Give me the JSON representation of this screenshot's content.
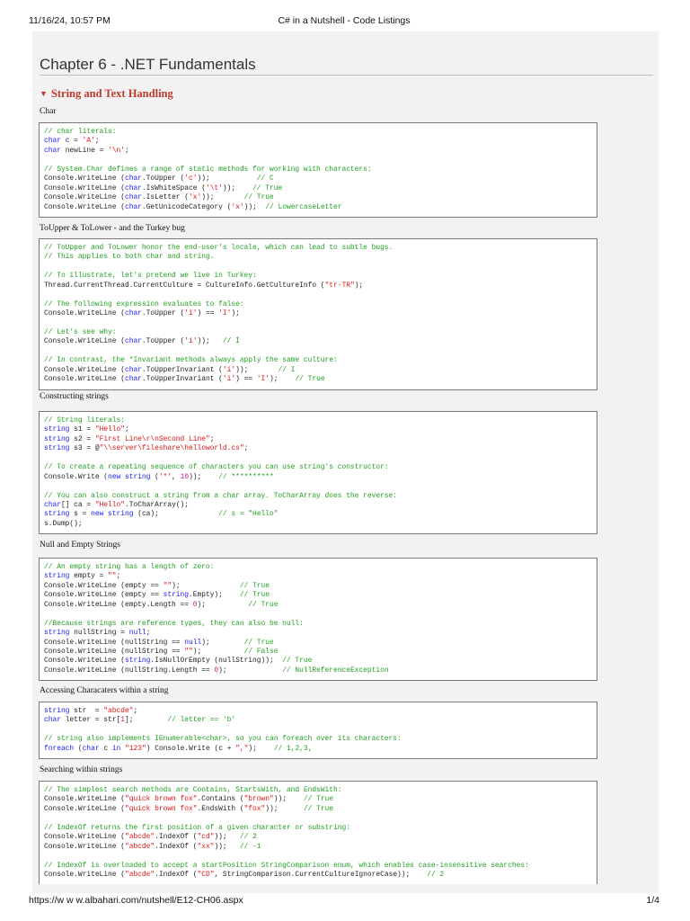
{
  "header": {
    "datetime": "11/16/24, 10:57 PM",
    "doc_title": "C# in a Nutshell - Code Listings"
  },
  "footer": {
    "url": "https://w w w.albahari.com/nutshell/E12-CH06.aspx",
    "page": "1/4"
  },
  "chapter_title": "Chapter 6 - .NET Fundamentals",
  "section": {
    "icon": "triangle-down-icon",
    "title": "String and Text Handling"
  },
  "colors": {
    "comment": "#22a022",
    "keyword": "#1a1aff",
    "string": "#e01515",
    "number": "#c0188c",
    "section": "#c0392b"
  },
  "blocks": [
    {
      "label": "Char",
      "lines": [
        [
          [
            "c",
            "// char literals:"
          ]
        ],
        [
          [
            "k",
            "char"
          ],
          [
            "p",
            " c = "
          ],
          [
            "s",
            "'A'"
          ],
          [
            "p",
            ";"
          ]
        ],
        [
          [
            "k",
            "char"
          ],
          [
            "p",
            " newLine = "
          ],
          [
            "s",
            "'\\n'"
          ],
          [
            "p",
            ";"
          ]
        ],
        [],
        [
          [
            "c",
            "// System.Char defines a range of static methods for working with characters:"
          ]
        ],
        [
          [
            "p",
            "Console.WriteLine ("
          ],
          [
            "k",
            "char"
          ],
          [
            "p",
            ".ToUpper ("
          ],
          [
            "s",
            "'c'"
          ],
          [
            "p",
            "));           "
          ],
          [
            "c",
            "// C"
          ]
        ],
        [
          [
            "p",
            "Console.WriteLine ("
          ],
          [
            "k",
            "char"
          ],
          [
            "p",
            ".IsWhiteSpace ("
          ],
          [
            "s",
            "'\\t'"
          ],
          [
            "p",
            "));    "
          ],
          [
            "c",
            "// True"
          ]
        ],
        [
          [
            "p",
            "Console.WriteLine ("
          ],
          [
            "k",
            "char"
          ],
          [
            "p",
            ".IsLetter ("
          ],
          [
            "s",
            "'x'"
          ],
          [
            "p",
            "));       "
          ],
          [
            "c",
            "// True"
          ]
        ],
        [
          [
            "p",
            "Console.WriteLine ("
          ],
          [
            "k",
            "char"
          ],
          [
            "p",
            ".GetUnicodeCategory ("
          ],
          [
            "s",
            "'x'"
          ],
          [
            "p",
            "));  "
          ],
          [
            "c",
            "// LowercaseLetter"
          ]
        ]
      ]
    },
    {
      "label": "ToUpper & ToLower - and the Turkey bug",
      "lines": [
        [
          [
            "c",
            "// ToUpper and ToLower honor the end-user's locale, which can lead to subtle bugs."
          ]
        ],
        [
          [
            "c",
            "// This applies to both char and string."
          ]
        ],
        [],
        [
          [
            "c",
            "// To illustrate, let's pretend we live in Turkey:"
          ]
        ],
        [
          [
            "p",
            "Thread.CurrentThread.CurrentCulture = CultureInfo.GetCultureInfo ("
          ],
          [
            "s",
            "\"tr-TR\""
          ],
          [
            "p",
            ");"
          ]
        ],
        [],
        [
          [
            "c",
            "// The following expression evaluates to false:"
          ]
        ],
        [
          [
            "p",
            "Console.WriteLine ("
          ],
          [
            "k",
            "char"
          ],
          [
            "p",
            ".ToUpper ("
          ],
          [
            "s",
            "'i'"
          ],
          [
            "p",
            ") == "
          ],
          [
            "s",
            "'I'"
          ],
          [
            "p",
            ");"
          ]
        ],
        [],
        [
          [
            "c",
            "// Let's see why:"
          ]
        ],
        [
          [
            "p",
            "Console.WriteLine ("
          ],
          [
            "k",
            "char"
          ],
          [
            "p",
            ".ToUpper ("
          ],
          [
            "s",
            "'i'"
          ],
          [
            "p",
            "));   "
          ],
          [
            "c",
            "// İ"
          ]
        ],
        [],
        [
          [
            "c",
            "// In contrast, the *Invariant methods always apply the same culture:"
          ]
        ],
        [
          [
            "p",
            "Console.WriteLine ("
          ],
          [
            "k",
            "char"
          ],
          [
            "p",
            ".ToUpperInvariant ("
          ],
          [
            "s",
            "'i'"
          ],
          [
            "p",
            "));       "
          ],
          [
            "c",
            "// I"
          ]
        ],
        [
          [
            "p",
            "Console.WriteLine ("
          ],
          [
            "k",
            "char"
          ],
          [
            "p",
            ".ToUpperInvariant ("
          ],
          [
            "s",
            "'i'"
          ],
          [
            "p",
            ") == "
          ],
          [
            "s",
            "'I'"
          ],
          [
            "p",
            ");    "
          ],
          [
            "c",
            "// True"
          ]
        ]
      ]
    },
    {
      "label": "Constructing strings",
      "lines": [
        [
          [
            "c",
            "// String literals:"
          ]
        ],
        [
          [
            "k",
            "string"
          ],
          [
            "p",
            " s1 = "
          ],
          [
            "s",
            "\"Hello\""
          ],
          [
            "p",
            ";"
          ]
        ],
        [
          [
            "k",
            "string"
          ],
          [
            "p",
            " s2 = "
          ],
          [
            "s",
            "\"First Line\\r\\nSecond Line\""
          ],
          [
            "p",
            ";"
          ]
        ],
        [
          [
            "k",
            "string"
          ],
          [
            "p",
            " s3 = @"
          ],
          [
            "s",
            "\"\\\\server\\fileshare\\helloworld.cs\""
          ],
          [
            "p",
            ";"
          ]
        ],
        [],
        [
          [
            "c",
            "// To create a repeating sequence of characters you can use string's constructor:"
          ]
        ],
        [
          [
            "p",
            "Console.Write ("
          ],
          [
            "k",
            "new string"
          ],
          [
            "p",
            " ("
          ],
          [
            "s",
            "'*'"
          ],
          [
            "p",
            ", "
          ],
          [
            "n",
            "10"
          ],
          [
            "p",
            "));    "
          ],
          [
            "c",
            "// **********"
          ]
        ],
        [],
        [
          [
            "c",
            "// You can also construct a string from a char array. ToCharArray does the reverse:"
          ]
        ],
        [
          [
            "k",
            "char"
          ],
          [
            "p",
            "[] ca = "
          ],
          [
            "s",
            "\"Hello\""
          ],
          [
            "p",
            ".ToCharArray();"
          ]
        ],
        [
          [
            "k",
            "string"
          ],
          [
            "p",
            " s = "
          ],
          [
            "k",
            "new string"
          ],
          [
            "p",
            " (ca);              "
          ],
          [
            "c",
            "// s = \"Hello\""
          ]
        ],
        [
          [
            "p",
            "s.Dump();"
          ]
        ]
      ]
    },
    {
      "label": "Null and Empty Strings",
      "lines": [
        [
          [
            "c",
            "// An empty string has a length of zero:"
          ]
        ],
        [
          [
            "k",
            "string"
          ],
          [
            "p",
            " empty = "
          ],
          [
            "s",
            "\"\""
          ],
          [
            "p",
            ";"
          ]
        ],
        [
          [
            "p",
            "Console.WriteLine (empty == "
          ],
          [
            "s",
            "\"\""
          ],
          [
            "p",
            ");              "
          ],
          [
            "c",
            "// True"
          ]
        ],
        [
          [
            "p",
            "Console.WriteLine (empty == "
          ],
          [
            "k",
            "string"
          ],
          [
            "p",
            ".Empty);    "
          ],
          [
            "c",
            "// True"
          ]
        ],
        [
          [
            "p",
            "Console.WriteLine (empty.Length == "
          ],
          [
            "n",
            "0"
          ],
          [
            "p",
            ");          "
          ],
          [
            "c",
            "// True"
          ]
        ],
        [],
        [
          [
            "c",
            "//Because strings are reference types, they can also be null:"
          ]
        ],
        [
          [
            "k",
            "string"
          ],
          [
            "p",
            " nullString = "
          ],
          [
            "k",
            "null"
          ],
          [
            "p",
            ";"
          ]
        ],
        [
          [
            "p",
            "Console.WriteLine (nullString == "
          ],
          [
            "k",
            "null"
          ],
          [
            "p",
            ");        "
          ],
          [
            "c",
            "// True"
          ]
        ],
        [
          [
            "p",
            "Console.WriteLine (nullString == "
          ],
          [
            "s",
            "\"\""
          ],
          [
            "p",
            ");          "
          ],
          [
            "c",
            "// False"
          ]
        ],
        [
          [
            "p",
            "Console.WriteLine ("
          ],
          [
            "k",
            "string"
          ],
          [
            "p",
            ".IsNullOrEmpty (nullString));  "
          ],
          [
            "c",
            "// True"
          ]
        ],
        [
          [
            "p",
            "Console.WriteLine (nullString.Length == "
          ],
          [
            "n",
            "0"
          ],
          [
            "p",
            ");             "
          ],
          [
            "c",
            "// NullReferenceException"
          ]
        ]
      ]
    },
    {
      "label": "Accessing Characaters within a string",
      "lines": [
        [
          [
            "k",
            "string"
          ],
          [
            "p",
            " str  = "
          ],
          [
            "s",
            "\"abcde\""
          ],
          [
            "p",
            ";"
          ]
        ],
        [
          [
            "k",
            "char"
          ],
          [
            "p",
            " letter = str["
          ],
          [
            "n",
            "1"
          ],
          [
            "p",
            "];        "
          ],
          [
            "c",
            "// letter == 'b'"
          ]
        ],
        [],
        [
          [
            "c",
            "// string also implements IEnumerable<char>, so you can foreach over its characters:"
          ]
        ],
        [
          [
            "k",
            "foreach"
          ],
          [
            "p",
            " ("
          ],
          [
            "k",
            "char"
          ],
          [
            "p",
            " c "
          ],
          [
            "k",
            "in"
          ],
          [
            "p",
            " "
          ],
          [
            "s",
            "\"123\""
          ],
          [
            "p",
            ") Console.Write (c + "
          ],
          [
            "s",
            "\",\""
          ],
          [
            "p",
            ");    "
          ],
          [
            "c",
            "// 1,2,3,"
          ]
        ]
      ]
    },
    {
      "label": "Searching within strings",
      "lines": [
        [
          [
            "c",
            "// The simplest search methods are Contains, StartsWith, and EndsWith:"
          ]
        ],
        [
          [
            "p",
            "Console.WriteLine ("
          ],
          [
            "s",
            "\"quick brown fox\""
          ],
          [
            "p",
            ".Contains ("
          ],
          [
            "s",
            "\"brown\""
          ],
          [
            "p",
            "));    "
          ],
          [
            "c",
            "// True"
          ]
        ],
        [
          [
            "p",
            "Console.WriteLine ("
          ],
          [
            "s",
            "\"quick brown fox\""
          ],
          [
            "p",
            ".EndsWith ("
          ],
          [
            "s",
            "\"fox\""
          ],
          [
            "p",
            "));      "
          ],
          [
            "c",
            "// True"
          ]
        ],
        [],
        [
          [
            "c",
            "// IndexOf returns the first position of a given character or substring:"
          ]
        ],
        [
          [
            "p",
            "Console.WriteLine ("
          ],
          [
            "s",
            "\"abcde\""
          ],
          [
            "p",
            ".IndexOf ("
          ],
          [
            "s",
            "\"cd\""
          ],
          [
            "p",
            "));   "
          ],
          [
            "c",
            "// 2"
          ]
        ],
        [
          [
            "p",
            "Console.WriteLine ("
          ],
          [
            "s",
            "\"abcde\""
          ],
          [
            "p",
            ".IndexOf ("
          ],
          [
            "s",
            "\"xx\""
          ],
          [
            "p",
            "));   "
          ],
          [
            "c",
            "// -1"
          ]
        ],
        [],
        [
          [
            "c",
            "// IndexOf is overloaded to accept a startPosition StringComparison enum, which enables case-insensitive searches:"
          ]
        ],
        [
          [
            "p",
            "Console.WriteLine ("
          ],
          [
            "s",
            "\"abcde\""
          ],
          [
            "p",
            ".IndexOf ("
          ],
          [
            "s",
            "\"CD\""
          ],
          [
            "p",
            ", StringComparison.CurrentCultureIgnoreCase));    "
          ],
          [
            "c",
            "// 2"
          ]
        ]
      ]
    }
  ]
}
